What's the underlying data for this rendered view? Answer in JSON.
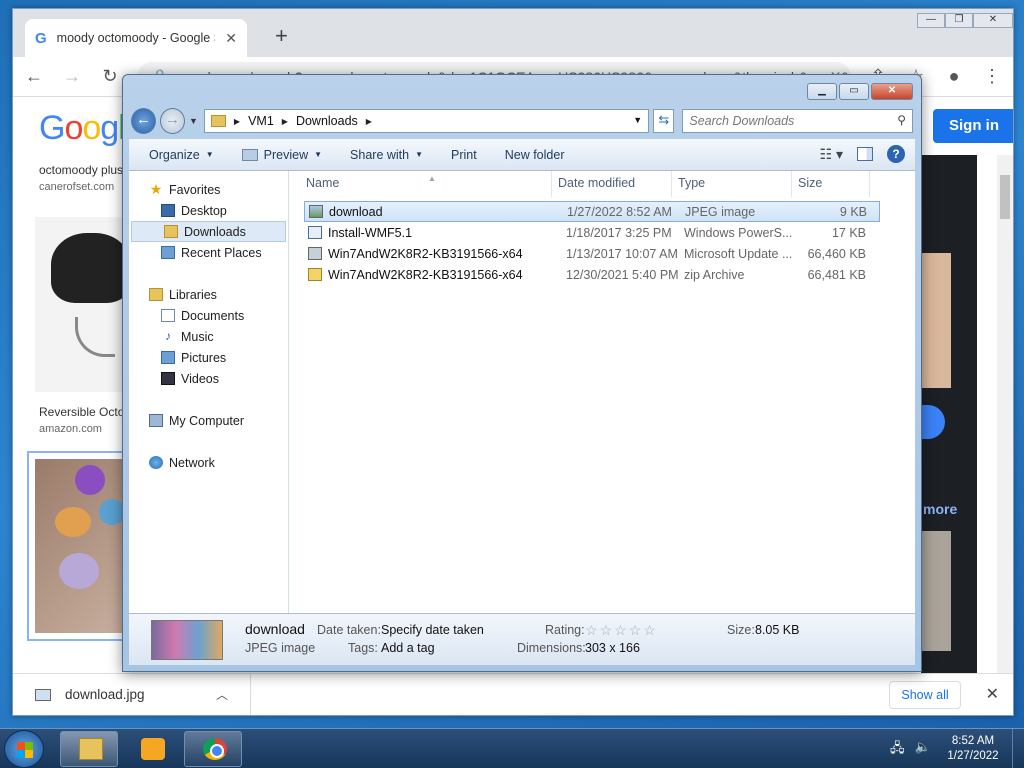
{
  "chrome": {
    "tab_title": "moody octomoody - Google Sea",
    "url": "google.com/search?q=moody+octomoody&rlz=1C1GCEA_enUS986US986&source=lnms&tbm=isch&sa=X&ved",
    "page": {
      "logo": "Google",
      "sign_in": "Sign in",
      "result1_title": "octomoody plus",
      "result1_source": "canerofset.com",
      "result2_title": "Reversible Octo",
      "result2_source": "amazon.com",
      "more": "more"
    },
    "downloads_bar": {
      "file_name": "download.jpg",
      "show_all": "Show all"
    }
  },
  "explorer": {
    "breadcrumb": [
      "VM1",
      "Downloads"
    ],
    "search_placeholder": "Search Downloads",
    "commands": {
      "organize": "Organize",
      "preview": "Preview",
      "share_with": "Share with",
      "print": "Print",
      "new_folder": "New folder"
    },
    "nav": {
      "favorites": "Favorites",
      "desktop": "Desktop",
      "downloads": "Downloads",
      "recent_places": "Recent Places",
      "libraries": "Libraries",
      "documents": "Documents",
      "music": "Music",
      "pictures": "Pictures",
      "videos": "Videos",
      "my_computer": "My Computer",
      "network": "Network"
    },
    "columns": {
      "name": "Name",
      "date_modified": "Date modified",
      "type": "Type",
      "size": "Size"
    },
    "files": [
      {
        "name": "download",
        "date": "1/27/2022 8:52 AM",
        "type": "JPEG image",
        "size": "9 KB",
        "icon": "image-icon"
      },
      {
        "name": "Install-WMF5.1",
        "date": "1/18/2017 3:25 PM",
        "type": "Windows PowerS...",
        "size": "17 KB",
        "icon": "powershell-script-icon"
      },
      {
        "name": "Win7AndW2K8R2-KB3191566-x64",
        "date": "1/13/2017 10:07 AM",
        "type": "Microsoft Update ...",
        "size": "66,460 KB",
        "icon": "update-package-icon"
      },
      {
        "name": "Win7AndW2K8R2-KB3191566-x64",
        "date": "12/30/2021 5:40 PM",
        "type": "zip Archive",
        "size": "66,481 KB",
        "icon": "zip-icon"
      }
    ],
    "details": {
      "name": "download",
      "type": "JPEG image",
      "date_taken_label": "Date taken:",
      "date_taken_value": "Specify date taken",
      "tags_label": "Tags:",
      "tags_value": "Add a tag",
      "rating_label": "Rating:",
      "rating": 0,
      "dimensions_label": "Dimensions:",
      "dimensions_value": "303 x 166",
      "size_label": "Size:",
      "size_value": "8.05 KB"
    }
  },
  "taskbar": {
    "time": "8:52 AM",
    "date": "1/27/2022"
  }
}
